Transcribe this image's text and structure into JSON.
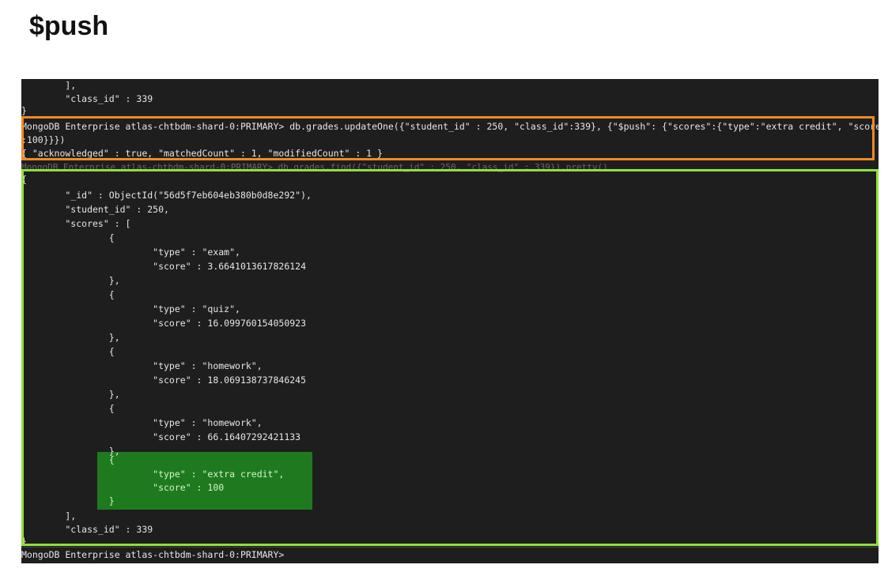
{
  "title": "$push",
  "terminal": {
    "lines": [
      "        ],",
      "        \"class_id\" : 339",
      "}",
      "MongoDB Enterprise atlas-chtbdm-shard-0:PRIMARY> db.grades.updateOne({\"student_id\" : 250, \"class_id\":339}, {\"$push\": {\"scores\":{\"type\":\"extra credit\", \"score\"",
      ":100}}})",
      "{ \"acknowledged\" : true, \"matchedCount\" : 1, \"modifiedCount\" : 1 }",
      "MongoDB Enterprise atlas-chtbdm-shard-0:PRIMARY> db.grades.find({\"student_id\" : 250, \"class_id\" : 339}).pretty()",
      "{",
      "        \"_id\" : ObjectId(\"56d5f7eb604eb380b0d8e292\"),",
      "        \"student_id\" : 250,",
      "        \"scores\" : [",
      "                {",
      "                        \"type\" : \"exam\",",
      "                        \"score\" : 3.6641013617826124",
      "                },",
      "                {",
      "                        \"type\" : \"quiz\",",
      "                        \"score\" : 16.099760154050923",
      "                },",
      "                {",
      "                        \"type\" : \"homework\",",
      "                        \"score\" : 18.069138737846245",
      "                },",
      "                {",
      "                        \"type\" : \"homework\",",
      "                        \"score\" : 66.16407292421133",
      "                },",
      "                {",
      "                        \"type\" : \"extra credit\",",
      "                        \"score\" : 100",
      "                }",
      "        ],",
      "        \"class_id\" : 339",
      "}",
      "MongoDB Enterprise atlas-chtbdm-shard-0:PRIMARY>"
    ]
  },
  "colors": {
    "terminal_bg": "#1e1e1e",
    "command_box": "#f08a24",
    "result_box": "#8fe03a",
    "new_item_highlight": "#1f7a1f"
  }
}
